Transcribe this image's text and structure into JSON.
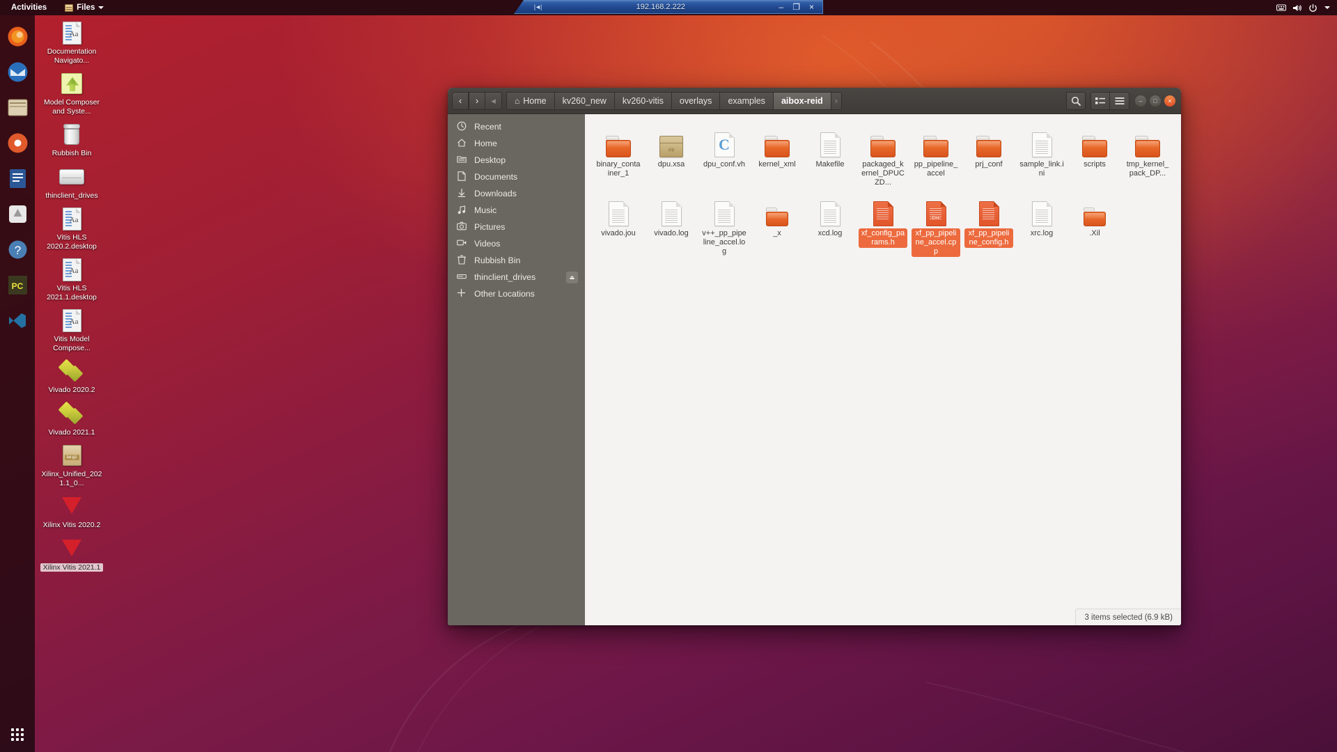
{
  "top_panel": {
    "activities": "Activities",
    "app_menu": "Files",
    "indicators": [
      "keyboard-icon",
      "volume-icon",
      "power-icon",
      "chevron-down-icon"
    ]
  },
  "remote_window": {
    "title": "192.168.2.222",
    "minimize": "–",
    "restore": "❐",
    "close": "×"
  },
  "dock": {
    "items": [
      {
        "name": "firefox",
        "color": "#e8601c"
      },
      {
        "name": "thunderbird",
        "color": "#2a6fbb"
      },
      {
        "name": "files",
        "color": "#d8c7a8"
      },
      {
        "name": "rhythmbox",
        "color": "#e05a2b"
      },
      {
        "name": "libreoffice-writer",
        "color": "#2b5797"
      },
      {
        "name": "software",
        "color": "#e0e0e0"
      },
      {
        "name": "help",
        "color": "#4a7fb5"
      },
      {
        "name": "pycharm",
        "color": "#f2e43c"
      },
      {
        "name": "vscode",
        "color": "#2472a4"
      }
    ],
    "show_apps_label": "Show Applications"
  },
  "desktop_icons": [
    {
      "label": "Documentation Navigato...",
      "icon": "document-icon",
      "selected": false
    },
    {
      "label": "Model Composer and Syste...",
      "icon": "model-composer-icon",
      "selected": false
    },
    {
      "label": "Rubbish Bin",
      "icon": "trash-icon",
      "selected": false
    },
    {
      "label": "thinclient_drives",
      "icon": "drive-icon",
      "selected": false
    },
    {
      "label": "Vitis HLS 2020.2.desktop",
      "icon": "document-icon",
      "selected": false
    },
    {
      "label": "Vitis HLS 2021.1.desktop",
      "icon": "document-icon",
      "selected": false
    },
    {
      "label": "Vitis Model Compose...",
      "icon": "document-icon",
      "selected": false
    },
    {
      "label": "Vivado 2020.2",
      "icon": "vivado-icon",
      "selected": false
    },
    {
      "label": "Vivado 2021.1",
      "icon": "vivado-icon",
      "selected": false
    },
    {
      "label": "Xilinx_Unified_2021.1_0...",
      "icon": "targz-archive-icon",
      "selected": false
    },
    {
      "label": "Xilinx Vitis 2020.2",
      "icon": "xilinx-vitis-icon",
      "selected": false
    },
    {
      "label": "Xilinx Vitis 2021.1",
      "icon": "xilinx-vitis-icon",
      "selected": true
    }
  ],
  "files_window": {
    "nav": {
      "back": "‹",
      "forward": "›",
      "drop": "◂"
    },
    "breadcrumbs": [
      {
        "label": "Home",
        "icon": "home-icon",
        "active": false
      },
      {
        "label": "kv260_new",
        "active": false
      },
      {
        "label": "kv260-vitis",
        "active": false
      },
      {
        "label": "overlays",
        "active": false
      },
      {
        "label": "examples",
        "active": false
      },
      {
        "label": "aibox-reid",
        "active": true
      }
    ],
    "breadcrumb_next": "›",
    "toolbar": {
      "search": "search-icon",
      "view_list": "view-list-icon",
      "menu": "hamburger-menu-icon"
    },
    "window_controls": {
      "minimize": "–",
      "maximize": "□",
      "close": "×"
    },
    "sidebar": [
      {
        "label": "Recent",
        "icon": "clock-icon"
      },
      {
        "label": "Home",
        "icon": "home-icon"
      },
      {
        "label": "Desktop",
        "icon": "desktop-folder-icon"
      },
      {
        "label": "Documents",
        "icon": "document-icon"
      },
      {
        "label": "Downloads",
        "icon": "download-arrow-icon"
      },
      {
        "label": "Music",
        "icon": "music-note-icon"
      },
      {
        "label": "Pictures",
        "icon": "camera-icon"
      },
      {
        "label": "Videos",
        "icon": "video-camera-icon"
      },
      {
        "label": "Rubbish Bin",
        "icon": "trash-icon"
      },
      {
        "label": "thinclient_drives",
        "icon": "drive-icon",
        "eject": "⏏"
      },
      {
        "label": "Other Locations",
        "icon": "plus-icon"
      }
    ],
    "files": [
      {
        "name": "binary_container_1",
        "type": "folder",
        "selected": false
      },
      {
        "name": "dpu.xsa",
        "type": "archive",
        "badge": "zip",
        "selected": false
      },
      {
        "name": "dpu_conf.vh",
        "type": "code-doc",
        "glyph": "C",
        "selected": false
      },
      {
        "name": "kernel_xml",
        "type": "folder",
        "selected": false
      },
      {
        "name": "Makefile",
        "type": "text",
        "selected": false
      },
      {
        "name": "packaged_kernel_DPUCZD...",
        "type": "folder",
        "selected": false
      },
      {
        "name": "pp_pipeline_accel",
        "type": "folder",
        "selected": false
      },
      {
        "name": "prj_conf",
        "type": "folder",
        "selected": false
      },
      {
        "name": "sample_link.ini",
        "type": "text",
        "selected": false
      },
      {
        "name": "scripts",
        "type": "folder",
        "selected": false
      },
      {
        "name": "tmp_kernel_pack_DP...",
        "type": "folder",
        "selected": false
      },
      {
        "name": "vivado.jou",
        "type": "text",
        "selected": false
      },
      {
        "name": "vivado.log",
        "type": "text",
        "selected": false
      },
      {
        "name": "v++_pp_pipeline_accel.log",
        "type": "text",
        "selected": false
      },
      {
        "name": "_x",
        "type": "folder-sm",
        "selected": false
      },
      {
        "name": "xcd.log",
        "type": "text",
        "selected": false
      },
      {
        "name": "xf_config_params.h",
        "type": "source",
        "badge": "",
        "selected": true
      },
      {
        "name": "xf_pp_pipeline_accel.cpp",
        "type": "source",
        "badge": "C++",
        "selected": true
      },
      {
        "name": "xf_pp_pipeline_config.h",
        "type": "source",
        "badge": "",
        "selected": true
      },
      {
        "name": "xrc.log",
        "type": "text",
        "selected": false
      },
      {
        "name": ".Xil",
        "type": "folder-sm",
        "selected": false
      }
    ],
    "status": "3 items selected  (6.9 kB)"
  },
  "colors": {
    "accent_orange": "#ec6a3d",
    "window_chrome": "#3f3b38",
    "sidebar_bg": "#6a6760",
    "file_area_bg": "#f4f3f2"
  }
}
